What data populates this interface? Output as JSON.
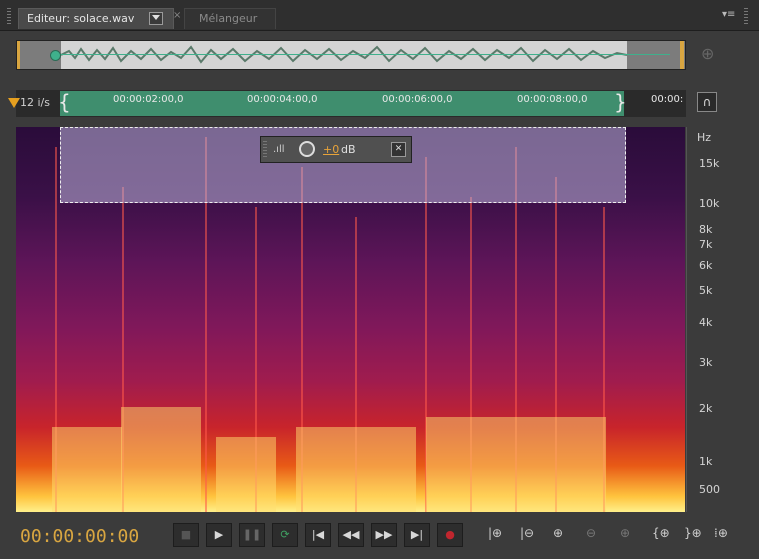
{
  "tabs": {
    "editor_label": "Editeur: solace.wav",
    "mixer_label": "Mélangeur",
    "close_glyph": "×",
    "panel_menu": "▾≡"
  },
  "overview": {
    "zoom_icon": "zoom-navigator-icon"
  },
  "timeline": {
    "unit_label": "12 i/s",
    "ticks": [
      "00:00:02:00,0",
      "00:00:04:00,0",
      "00:00:06:00,0",
      "00:00:08:00,0",
      "00:00:"
    ],
    "snap_icon": "magnet-icon"
  },
  "spectral": {
    "hud": {
      "value": "+0",
      "unit": "dB"
    },
    "ruler_labels": [
      "Hz",
      "15k",
      "10k",
      "8k",
      "7k",
      "6k",
      "5k",
      "4k",
      "3k",
      "2k",
      "1k",
      "500"
    ]
  },
  "transport": {
    "timecode": "00:00:00:00",
    "buttons": [
      "stop",
      "play",
      "pause",
      "loop",
      "go-to-start",
      "rewind",
      "fast-forward",
      "go-to-end",
      "record"
    ],
    "record_color": "#c0262e",
    "loop_color": "#3fa062"
  },
  "zoom_controls": [
    "zoom-in-amplitude",
    "zoom-out-amplitude",
    "zoom-in-time",
    "zoom-out-time",
    "zoom-full",
    "zoom-in-left",
    "zoom-in-right",
    "zoom-selection"
  ]
}
